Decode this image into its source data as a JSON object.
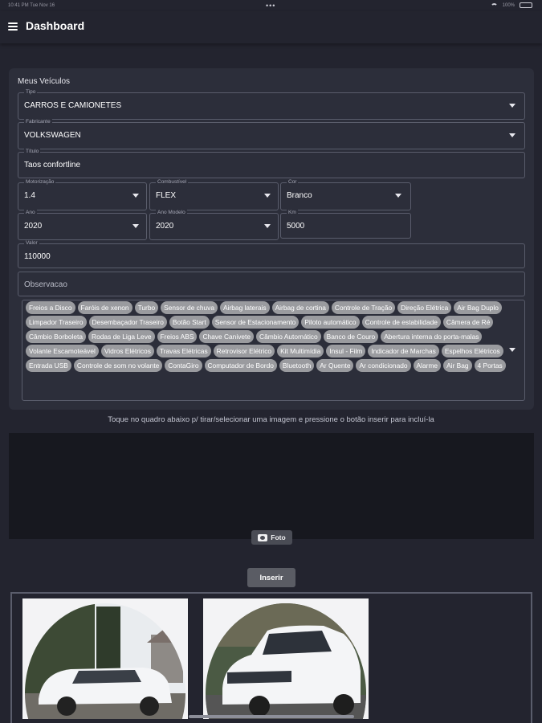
{
  "status_bar": {
    "time": "10:41 PM   Tue Nov 16",
    "battery": "100%"
  },
  "appbar": {
    "title": "Dashboard"
  },
  "form": {
    "section_title": "Meus Veículos",
    "tipo": {
      "label": "Tipo",
      "value": "CARROS E CAMIONETES"
    },
    "fabricante": {
      "label": "Fabricante",
      "value": "VOLKSWAGEN"
    },
    "titulo": {
      "label": "Título",
      "value": "Taos confortline"
    },
    "motorizacao": {
      "label": "Motorização",
      "value": "1.4"
    },
    "combustivel": {
      "label": "Combustível",
      "value": "FLEX"
    },
    "cor": {
      "label": "Cor",
      "value": "Branco"
    },
    "ano": {
      "label": "Ano",
      "value": "2020"
    },
    "ano_modelo": {
      "label": "Ano Modelo",
      "value": "2020"
    },
    "km": {
      "label": "Km",
      "value": "5000"
    },
    "valor": {
      "label": "Valor",
      "value": "110000"
    },
    "observacao": {
      "placeholder": "Observacao"
    },
    "opcionais": [
      "Freios a Disco",
      "Faróis de xenon",
      "Turbo",
      "Sensor de chuva",
      "Airbag laterais",
      "Airbag de cortina",
      "Controle de Tração",
      "Direção Elétrica",
      "Air Bag Duplo",
      "Limpador Traseiro",
      "Desembaçador Traseiro",
      "Botão Start",
      "Sensor de Estacionamento",
      "Piloto automático",
      "Controle de estabilidade",
      "Câmera de Ré",
      "Câmbio Borboleta",
      "Rodas de Liga Leve",
      "Freios ABS",
      "Chave Canivete",
      "Câmbio Automático",
      "Banco de Couro",
      "Abertura interna do porta-malas",
      "Volante Escamoteável",
      "Vidros Elétricos",
      "Travas Elétricas",
      "Retrovisor Elétrico",
      "Kit Multimídia",
      "Insul - Film",
      "Indicador de Marchas",
      "Espelhos Elétricos",
      "Entrada USB",
      "Controle de som no volante",
      "ContaGiro",
      "Computador de Bordo",
      "Bluetooth",
      "Ar Quente",
      "Ar condicionado",
      "Alarme",
      "Air Bag",
      "4 Portas"
    ]
  },
  "images": {
    "hint": "Toque no quadro abaixo p/ tirar/selecionar uma imagem e pressione o botão inserir para incluí-la",
    "foto_label": "Foto",
    "inserir_label": "Inserir"
  },
  "colors": {
    "background": "#23242f",
    "card": "#2c2e3a",
    "chip": "#9a9b9f",
    "image_area": "#17181f"
  }
}
